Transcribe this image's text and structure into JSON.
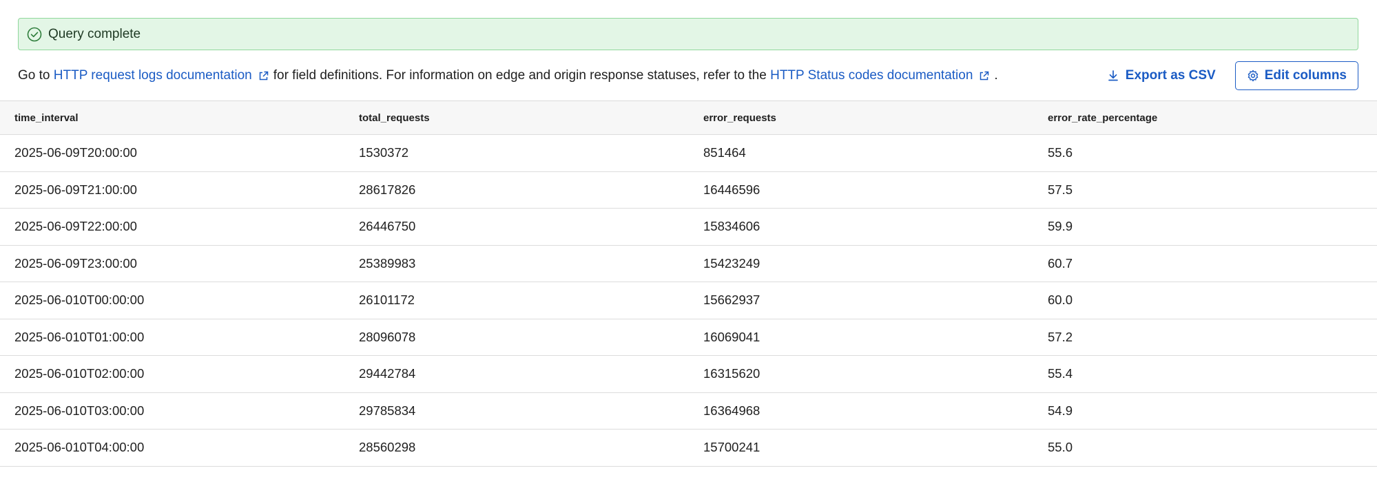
{
  "banner": {
    "message": "Query complete",
    "icon": "check-circle-icon",
    "color": "#e3f6e6"
  },
  "info": {
    "prefix": "Go to",
    "link1": "HTTP request logs documentation",
    "middle": "for field definitions. For information on edge and origin response statuses, refer to the",
    "link2": "HTTP Status codes documentation",
    "suffix": "."
  },
  "toolbar": {
    "export_label": "Export as CSV",
    "edit_label": "Edit columns",
    "accent": "#1a5bc4"
  },
  "table": {
    "columns": [
      "time_interval",
      "total_requests",
      "error_requests",
      "error_rate_percentage"
    ],
    "rows": [
      [
        "2025-06-09T20:00:00",
        "1530372",
        "851464",
        "55.6"
      ],
      [
        "2025-06-09T21:00:00",
        "28617826",
        "16446596",
        "57.5"
      ],
      [
        "2025-06-09T22:00:00",
        "26446750",
        "15834606",
        "59.9"
      ],
      [
        "2025-06-09T23:00:00",
        "25389983",
        "15423249",
        "60.7"
      ],
      [
        "2025-06-010T00:00:00",
        "26101172",
        "15662937",
        "60.0"
      ],
      [
        "2025-06-010T01:00:00",
        "28096078",
        "16069041",
        "57.2"
      ],
      [
        "2025-06-010T02:00:00",
        "29442784",
        "16315620",
        "55.4"
      ],
      [
        "2025-06-010T03:00:00",
        "29785834",
        "16364968",
        "54.9"
      ],
      [
        "2025-06-010T04:00:00",
        "28560298",
        "15700241",
        "55.0"
      ]
    ]
  }
}
